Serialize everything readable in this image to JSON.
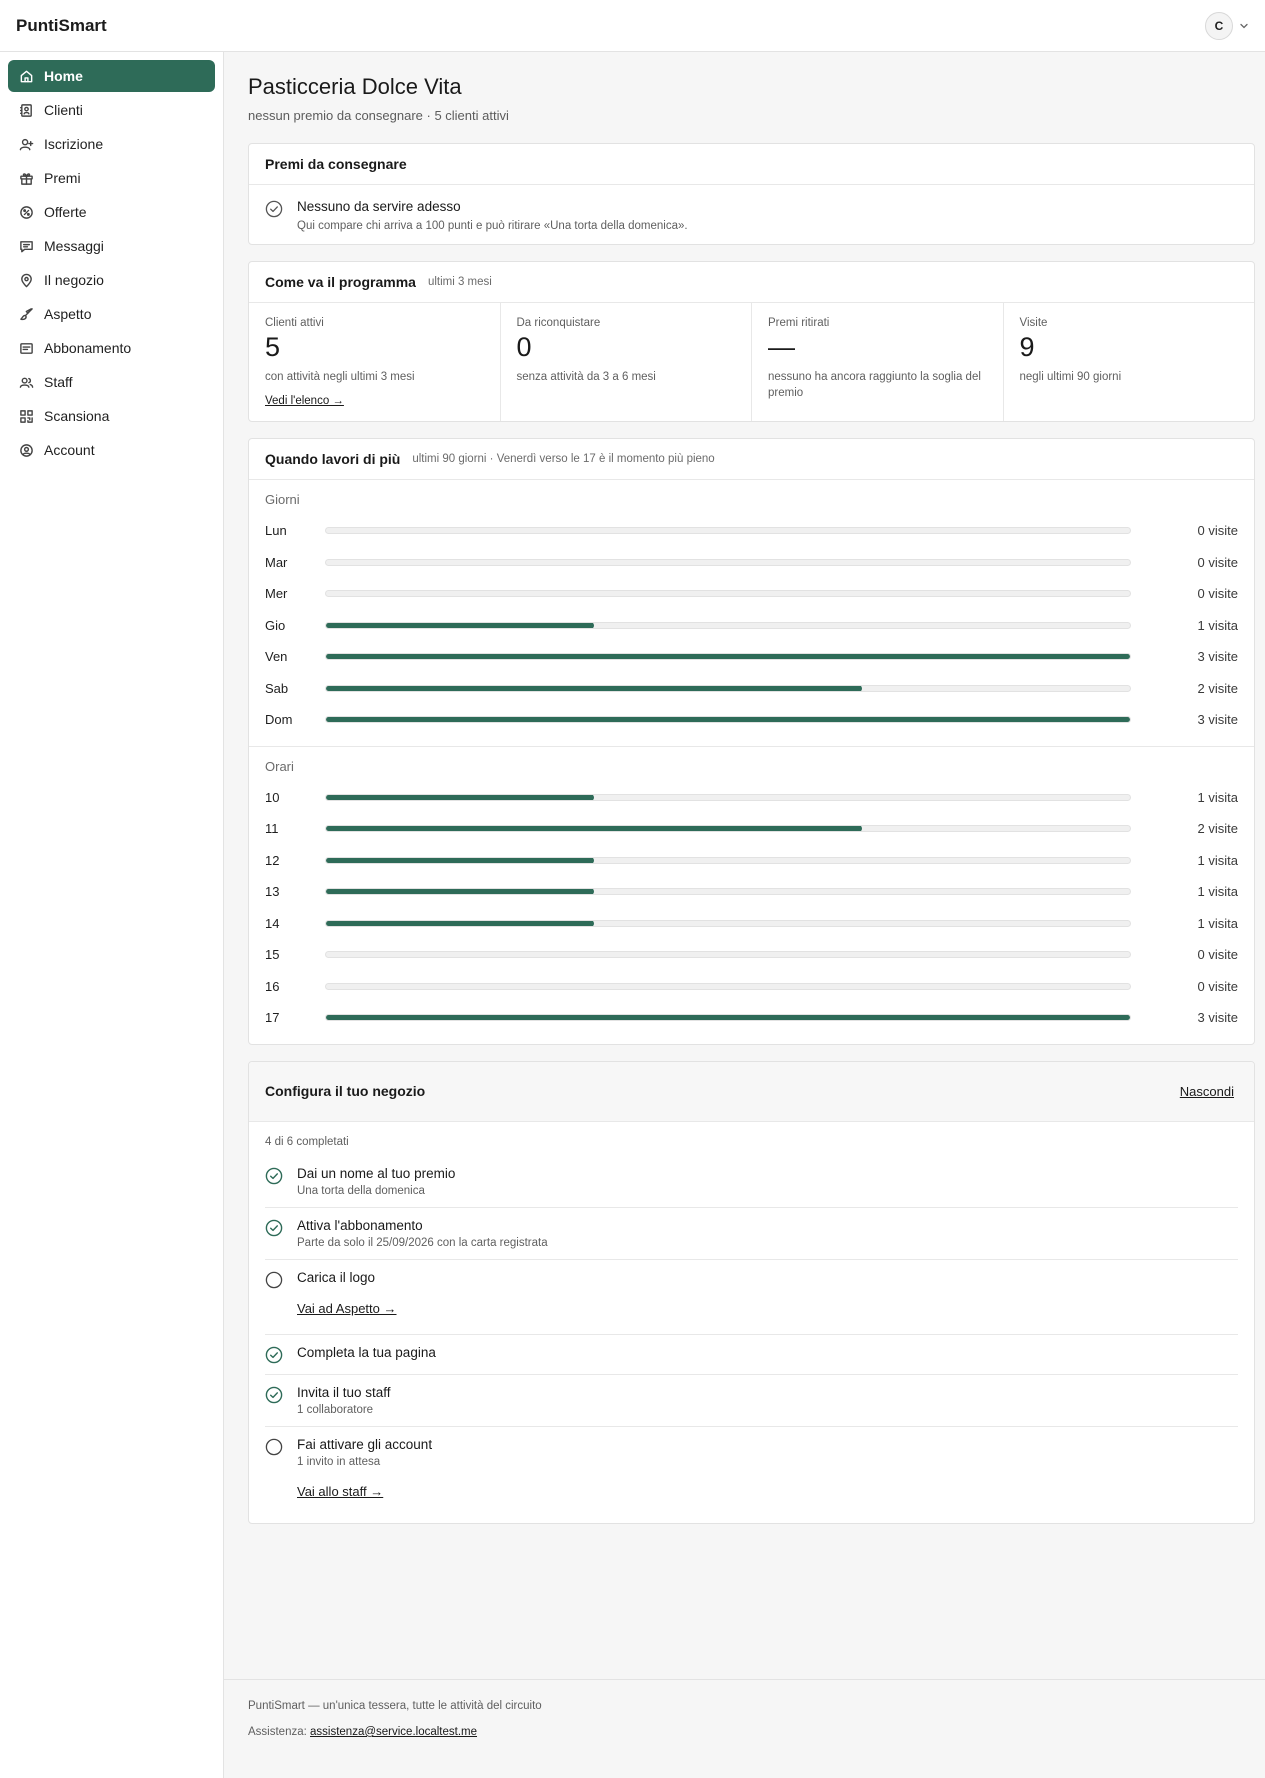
{
  "app": {
    "brand": "PuntiSmart",
    "user_initial": "C"
  },
  "sidebar": {
    "items": [
      {
        "label": "Home",
        "icon": "home-icon",
        "active": true
      },
      {
        "label": "Clienti",
        "icon": "contacts-icon"
      },
      {
        "label": "Iscrizione",
        "icon": "user-plus-icon"
      },
      {
        "label": "Premi",
        "icon": "gift-icon"
      },
      {
        "label": "Offerte",
        "icon": "badge-percent-icon"
      },
      {
        "label": "Messaggi",
        "icon": "message-icon"
      },
      {
        "label": "Il negozio",
        "icon": "map-pin-icon"
      },
      {
        "label": "Aspetto",
        "icon": "brush-icon"
      },
      {
        "label": "Abbonamento",
        "icon": "receipt-icon"
      },
      {
        "label": "Staff",
        "icon": "users-icon"
      },
      {
        "label": "Scansiona",
        "icon": "qr-code-icon"
      },
      {
        "label": "Account",
        "icon": "user-circle-icon"
      }
    ]
  },
  "page": {
    "title": "Pasticceria Dolce Vita",
    "subtitle": "nessun premio da consegnare · 5 clienti attivi"
  },
  "premi": {
    "title": "Premi da consegnare",
    "empty_title": "Nessuno da servire adesso",
    "empty_desc": "Qui compare chi arriva a 100 punti e può ritirare «Una torta della domenica»."
  },
  "program": {
    "title": "Come va il programma",
    "hint": "ultimi 3 mesi",
    "stats": [
      {
        "label": "Clienti attivi",
        "value": "5",
        "note": "con attività negli ultimi 3 mesi",
        "link": "Vedi l'elenco →"
      },
      {
        "label": "Da riconquistare",
        "value": "0",
        "note": "senza attività da 3 a 6 mesi"
      },
      {
        "label": "Premi ritirati",
        "value": "—",
        "note": "nessuno ha ancora raggiunto la soglia del premio"
      },
      {
        "label": "Visite",
        "value": "9",
        "note": "negli ultimi 90 giorni"
      }
    ]
  },
  "busy": {
    "title": "Quando lavori di più",
    "hint": "ultimi 90 giorni · Venerdì verso le 17 è il momento più pieno",
    "days_label": "Giorni",
    "days": [
      {
        "name": "Lun",
        "count": "0 visite",
        "value": 0
      },
      {
        "name": "Mar",
        "count": "0 visite",
        "value": 0
      },
      {
        "name": "Mer",
        "count": "0 visite",
        "value": 0
      },
      {
        "name": "Gio",
        "count": "1 visita",
        "value": 1
      },
      {
        "name": "Ven",
        "count": "3 visite",
        "value": 3
      },
      {
        "name": "Sab",
        "count": "2 visite",
        "value": 2
      },
      {
        "name": "Dom",
        "count": "3 visite",
        "value": 3
      }
    ],
    "hours_label": "Orari",
    "hours": [
      {
        "name": "10",
        "count": "1 visita",
        "value": 1
      },
      {
        "name": "11",
        "count": "2 visite",
        "value": 2
      },
      {
        "name": "12",
        "count": "1 visita",
        "value": 1
      },
      {
        "name": "13",
        "count": "1 visita",
        "value": 1
      },
      {
        "name": "14",
        "count": "1 visita",
        "value": 1
      },
      {
        "name": "15",
        "count": "0 visite",
        "value": 0
      },
      {
        "name": "16",
        "count": "0 visite",
        "value": 0
      },
      {
        "name": "17",
        "count": "3 visite",
        "value": 3
      }
    ],
    "max": 3
  },
  "config": {
    "title": "Configura il tuo negozio",
    "hide_label": "Nascondi",
    "progress": "4 di 6 completati",
    "tasks": [
      {
        "title": "Dai un nome al tuo premio",
        "desc": "Una torta della domenica",
        "done": true
      },
      {
        "title": "Attiva l'abbonamento",
        "desc": "Parte da solo il 25/09/2026 con la carta registrata",
        "done": true
      },
      {
        "title": "Carica il logo",
        "link": "Vai ad Aspetto →",
        "done": false
      },
      {
        "title": "Completa la tua pagina",
        "done": true
      },
      {
        "title": "Invita il tuo staff",
        "desc": "1 collaboratore",
        "done": true
      },
      {
        "title": "Fai attivare gli account",
        "desc": "1 invito in attesa",
        "link": "Vai allo staff →",
        "done": false
      }
    ]
  },
  "footer": {
    "tagline": "PuntiSmart — un'unica tessera, tutte le attività del circuito",
    "support_label": "Assistenza:",
    "support_email": "assistenza@service.localtest.me"
  },
  "colors": {
    "accent": "#2e6b58",
    "track": "#f0f0f0"
  }
}
